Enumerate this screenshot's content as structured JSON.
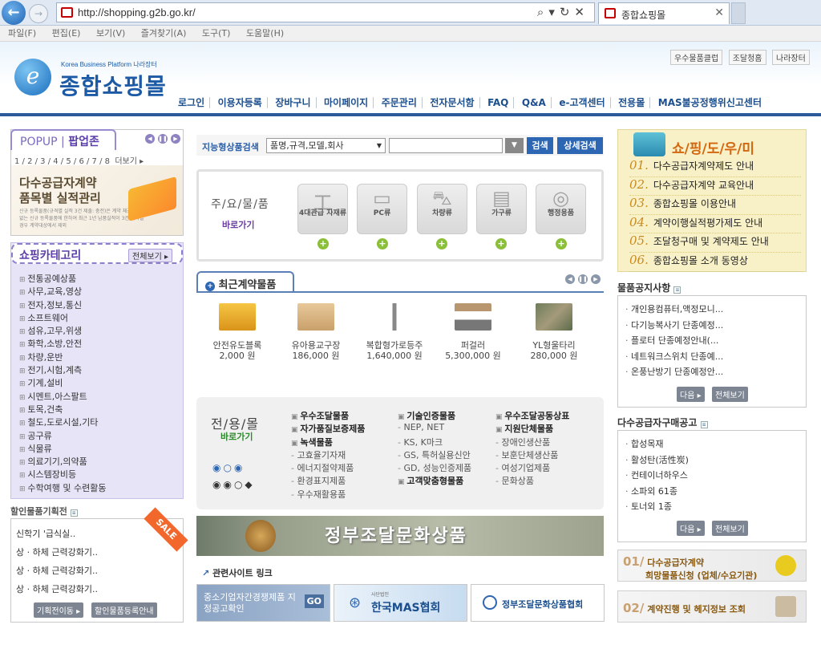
{
  "browser": {
    "url": "http://shopping.g2b.go.kr/",
    "tab_title": "종합쇼핑몰",
    "menu": [
      "파일(F)",
      "편집(E)",
      "보기(V)",
      "즐겨찾기(A)",
      "도구(T)",
      "도움말(H)"
    ]
  },
  "header": {
    "logo_sub": "Korea Business Platform 나라장터",
    "logo_main": "종합쇼핑몰",
    "top_links": [
      "우수물품클럽",
      "조달청홈",
      "나라장터"
    ],
    "gnb": [
      "로그인",
      "이용자등록",
      "장바구니",
      "마이페이지",
      "주문관리",
      "전자문서함",
      "FAQ",
      "Q&A",
      "e-고객센터",
      "전용몰",
      "MAS불공정행위신고센터"
    ]
  },
  "popup": {
    "title_a": "POPUP",
    "title_b": "팝업존",
    "nums": "1 / 2 / 3 / 4 / 5 / 6 / 7 / 8",
    "more": "더보기",
    "banner_line1": "다수공급자계약",
    "banner_line2": "품목별 실적관리",
    "banner_small": "신규 등록물품(규격별 실적 3건 제출: 충전)은 계약 체결한 적이 없는 신규 등록물품에 한하여 최근 1년 납품실적이 3건 이하일 경우 계약대상에서 제외"
  },
  "category": {
    "title": "쇼핑카테고리",
    "all": "전체보기",
    "items": [
      "전통공예상품",
      "사무,교육,영상",
      "전자,정보,통신",
      "소프트웨어",
      "섬유,고무,위생",
      "화학,소방,안전",
      "차량,운반",
      "전기,시험,계측",
      "기계,설비",
      "시멘트,아스팔트",
      "토목,건축",
      "철도,도로시설,기타",
      "공구류",
      "식물류",
      "의료기기,의약품",
      "시스템장비등",
      "수학여행 및 수련활동"
    ]
  },
  "sale": {
    "title": "할인물품기획전",
    "ribbon": "SALE",
    "items": [
      "신학기 '급식실..",
      "상 · 하체 근력강화기..",
      "상 · 하체 근력강화기..",
      "상 · 하체 근력강화기.."
    ],
    "btn1": "기획전이동",
    "btn2": "할인물품등록안내"
  },
  "search": {
    "label": "지능형상품검색",
    "select": "품명,규격,모델,회사",
    "search_btn": "검색",
    "detail_btn": "상세검색"
  },
  "goods": {
    "left_title": "주/요/물/품",
    "left_sub": "바로가기",
    "items": [
      "4대관급 자재류",
      "PC류",
      "차량류",
      "가구류",
      "행정용품"
    ]
  },
  "recent": {
    "title": "최근계약물품",
    "items": [
      {
        "name": "안전유도블록",
        "price": "2,000 원"
      },
      {
        "name": "유아용교구장",
        "price": "186,000 원"
      },
      {
        "name": "복합형가로등주",
        "price": "1,640,000 원"
      },
      {
        "name": "퍼걸러",
        "price": "5,300,000 원"
      },
      {
        "name": "YL형울타리",
        "price": "280,000 원"
      }
    ]
  },
  "special": {
    "left_title": "전/용/몰",
    "left_sub": "바로가기",
    "col1": [
      {
        "t": "우수조달물품",
        "h": true
      },
      {
        "t": "자가품질보증제품",
        "h": true
      },
      {
        "t": "녹색물품",
        "h": true
      },
      {
        "t": "고효율기자재",
        "h": false
      },
      {
        "t": "에너지절약제품",
        "h": false
      },
      {
        "t": "환경표지제품",
        "h": false
      },
      {
        "t": "우수재활용품",
        "h": false
      }
    ],
    "col2": [
      {
        "t": "기술인증물품",
        "h": true
      },
      {
        "t": "NEP, NET",
        "h": false
      },
      {
        "t": "KS, K마크",
        "h": false
      },
      {
        "t": "GS, 특허실용신안",
        "h": false
      },
      {
        "t": "GD, 성능인증제품",
        "h": false
      },
      {
        "t": "고객맞춤형물품",
        "h": true
      }
    ],
    "col3": [
      {
        "t": "우수조달공동상표",
        "h": true
      },
      {
        "t": "지원단체물품",
        "h": true
      },
      {
        "t": "장애인생산품",
        "h": false
      },
      {
        "t": "보훈단체생산품",
        "h": false
      },
      {
        "t": "여성기업제품",
        "h": false
      },
      {
        "t": "문화상품",
        "h": false
      }
    ]
  },
  "culture_banner": "정부조달문화상품",
  "related": {
    "title": "관련사이트 링크",
    "items": [
      "중소기업자간경쟁제품 지정공고확인",
      "GO",
      "한국MAS협회",
      "사단법인",
      "정부조달문화상품협회"
    ]
  },
  "guide": {
    "title": "쇼/핑/도/우/미",
    "items": [
      {
        "n": "01.",
        "t": "다수공급자계약제도 안내"
      },
      {
        "n": "02.",
        "t": "다수공급자계약 교육안내"
      },
      {
        "n": "03.",
        "t": "종합쇼핑몰 이용안내"
      },
      {
        "n": "04.",
        "t": "계약이행실적평가제도 안내"
      },
      {
        "n": "05.",
        "t": "조달청구매 및 계약제도 안내"
      },
      {
        "n": "06.",
        "t": "종합쇼핑몰 소개 동영상"
      }
    ]
  },
  "notice1": {
    "title": "물품공지사항",
    "items": [
      "개인용컴퓨터,액정모니...",
      "다기능복사기 단종예정...",
      "플로터 단종예정안내(...",
      "네트워크스위치 단종예...",
      "온풍난방기 단종예정안..."
    ],
    "next": "다음",
    "all": "전체보기"
  },
  "notice2": {
    "title": "다수공급자구매공고",
    "items": [
      "합성목재",
      "활성탄(活性炭)",
      "컨테이너하우스",
      "소파외 61종",
      "토너외 1종"
    ],
    "next": "다음",
    "all": "전체보기"
  },
  "rbanners": [
    {
      "n": "01/",
      "l1": "다수공급자계약",
      "l2": "희망물품신청 (업체/수요기관)"
    },
    {
      "n": "02/",
      "l1": "계약진행 및 헤지정보 조회",
      "l2": ""
    }
  ]
}
